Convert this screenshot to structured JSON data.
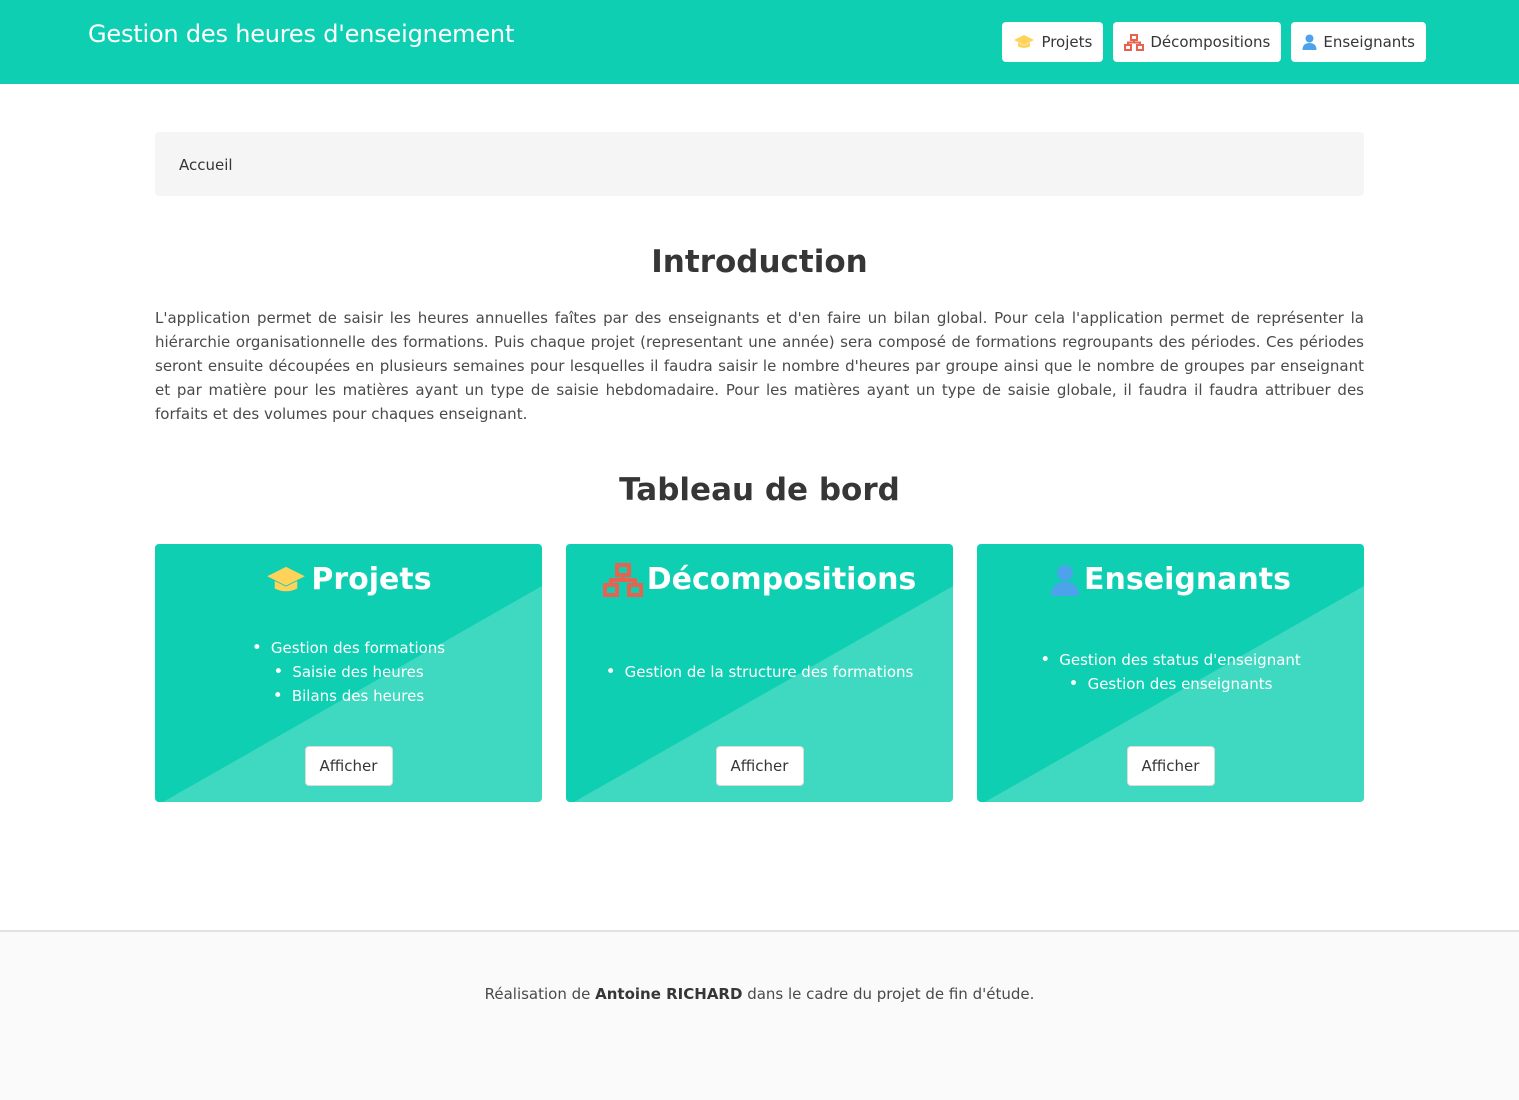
{
  "colors": {
    "primary": "#0fcfb2",
    "projets_icon": "#ffd35a",
    "decomp_icon": "#e8624f",
    "enseignants_icon": "#4ca3ec"
  },
  "navbar": {
    "brand": "Gestion des heures d'enseignement",
    "buttons": [
      {
        "label": "Projets",
        "icon": "graduation-cap-icon"
      },
      {
        "label": "Décompositions",
        "icon": "sitemap-icon"
      },
      {
        "label": "Enseignants",
        "icon": "user-icon"
      }
    ]
  },
  "breadcrumb": {
    "current": "Accueil"
  },
  "intro": {
    "title": "Introduction",
    "text": "L'application permet de saisir les heures annuelles faîtes par des enseignants et d'en faire un bilan global. Pour cela l'application permet de représenter la hiérarchie organisationnelle des formations. Puis chaque projet (representant une année) sera composé de formations regroupants des périodes. Ces périodes seront ensuite découpées en plusieurs semaines pour lesquelles il faudra saisir le nombre d'heures par groupe ainsi que le nombre de groupes par enseignant et par matière pour les matières ayant un type de saisie hebdomadaire. Pour les matières ayant un type de saisie globale, il faudra il faudra attribuer des forfaits et des volumes pour chaques enseignant."
  },
  "dashboard": {
    "title": "Tableau de bord",
    "cards": [
      {
        "title": "Projets",
        "icon": "graduation-cap-icon",
        "items": [
          "Gestion des formations",
          "Saisie des heures",
          "Bilans des heures"
        ],
        "button": "Afficher"
      },
      {
        "title": "Décompositions",
        "icon": "sitemap-icon",
        "items": [
          "Gestion de la structure des formations"
        ],
        "button": "Afficher"
      },
      {
        "title": "Enseignants",
        "icon": "user-icon",
        "items": [
          "Gestion des status d'enseignant",
          "Gestion des enseignants"
        ],
        "button": "Afficher"
      }
    ]
  },
  "footer": {
    "prefix": "Réalisation de ",
    "author": "Antoine RICHARD",
    "suffix": " dans le cadre du projet de fin d'étude."
  }
}
